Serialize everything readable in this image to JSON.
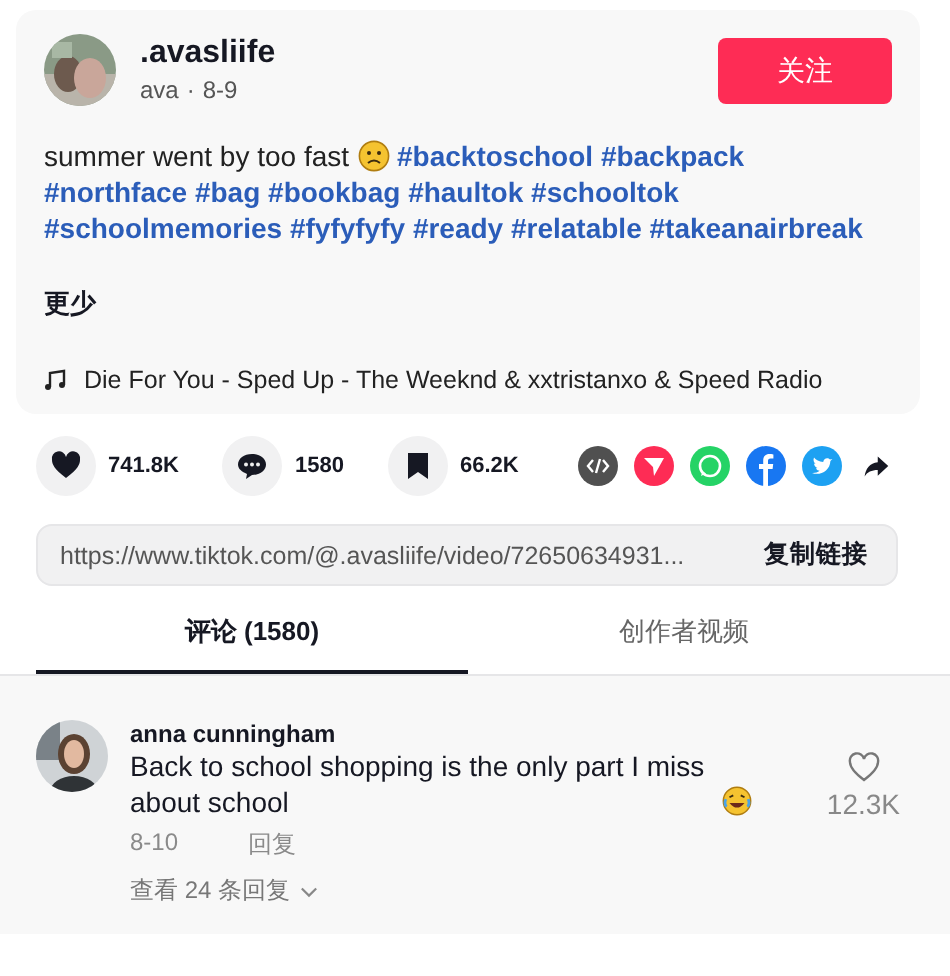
{
  "post": {
    "username": ".avasliife",
    "nickname": "ava",
    "separator": "·",
    "date": "8-9",
    "follow": "关注",
    "caption": "summer went by too fast",
    "hashtags": [
      "#backtoschool",
      "#backpack",
      "#northface",
      "#bag",
      "#bookbag",
      "#haultok",
      "#schooltok",
      "#schoolmemories",
      "#fyfyfyfy",
      "#ready",
      "#relatable",
      "#takeanairbreak"
    ],
    "less": "更少",
    "music": "Die For You - Sped Up - The Weeknd & xxtristanxo & Speed Radio"
  },
  "stats": [
    {
      "kind": "like",
      "count": "741.8K"
    },
    {
      "kind": "comment",
      "count": "1580"
    },
    {
      "kind": "save",
      "count": "66.2K"
    }
  ],
  "link": {
    "url": "https://www.tiktok.com/@.avasliife/video/72650634931...",
    "copy": "复制链接"
  },
  "tabs": [
    {
      "label": "评论 (1580)",
      "selected": true
    },
    {
      "label": "创作者视频",
      "selected": false
    }
  ],
  "comments": [
    {
      "user": "anna cunningham",
      "text": "Back to school shopping is the only part I miss about school",
      "date": "8-10",
      "reply": "回复",
      "likes": "12.3K",
      "view_replies": "查看 24 条回复"
    }
  ]
}
